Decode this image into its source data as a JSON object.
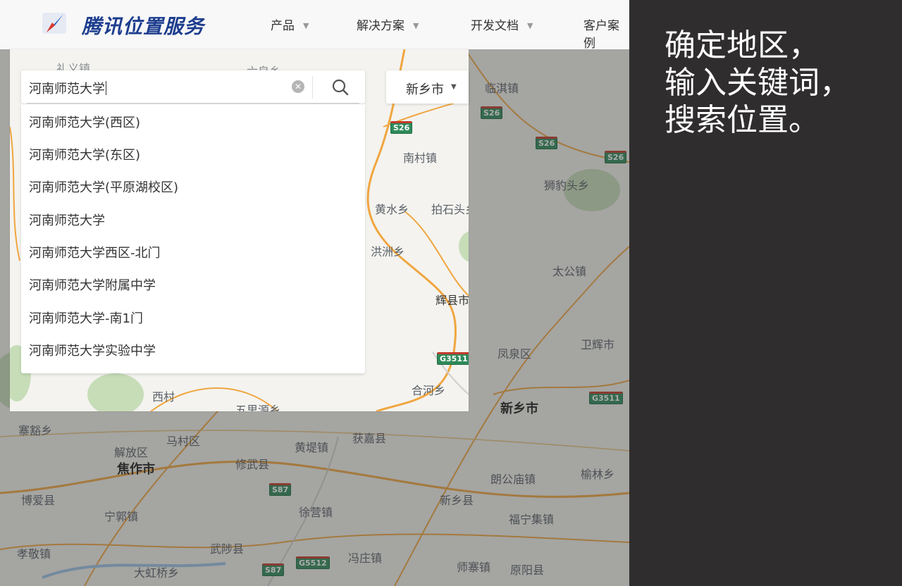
{
  "nav": {
    "logo_text": "腾讯位置服务",
    "items": [
      {
        "label": "产品"
      },
      {
        "label": "解决方案"
      },
      {
        "label": "开发文档"
      },
      {
        "label": "客户案例"
      }
    ]
  },
  "map": {
    "background_labels": [
      "礼义镇",
      "六泉乡",
      "临淇镇",
      "南村镇",
      "狮豹头乡",
      "黄水乡",
      "拍石头乡",
      "洪洲乡",
      "太公镇",
      "辉县市",
      "凤泉区",
      "卫辉市",
      "合河乡",
      "西村",
      "五里源乡",
      "新乡市",
      "寨豁乡",
      "马村区",
      "黄堤镇",
      "获嘉县",
      "解放区",
      "焦作市",
      "修武县",
      "朗公庙镇",
      "榆林乡",
      "博爱县",
      "新乡县",
      "宁郭镇",
      "徐营镇",
      "福宁集镇",
      "武陟县",
      "孝敬镇",
      "冯庄镇",
      "师寨镇",
      "大虹桥乡",
      "原阳县"
    ],
    "road_shields": [
      "S26",
      "S26",
      "S26",
      "S26",
      "G3511",
      "G3511",
      "S87",
      "S87",
      "G5512"
    ]
  },
  "search": {
    "value": "河南师范大学",
    "clear_icon": "clear-icon",
    "search_icon": "search-icon",
    "suggestions": [
      "河南师范大学(西区)",
      "河南师范大学(东区)",
      "河南师范大学(平原湖校区)",
      "河南师范大学",
      "河南师范大学西区-北门",
      "河南师范大学附属中学",
      "河南师范大学-南1门",
      "河南师范大学实验中学"
    ]
  },
  "city_select": {
    "value": "新乡市"
  },
  "instruction": {
    "line1": "确定地区，",
    "line2": "输入关键词，",
    "line3": "搜索位置。"
  },
  "colors": {
    "panel_bg": "#2f2d2d",
    "logo_blue": "#1d3d8e",
    "shield_green": "#2f8a5a",
    "road_orange": "#f0a640"
  }
}
